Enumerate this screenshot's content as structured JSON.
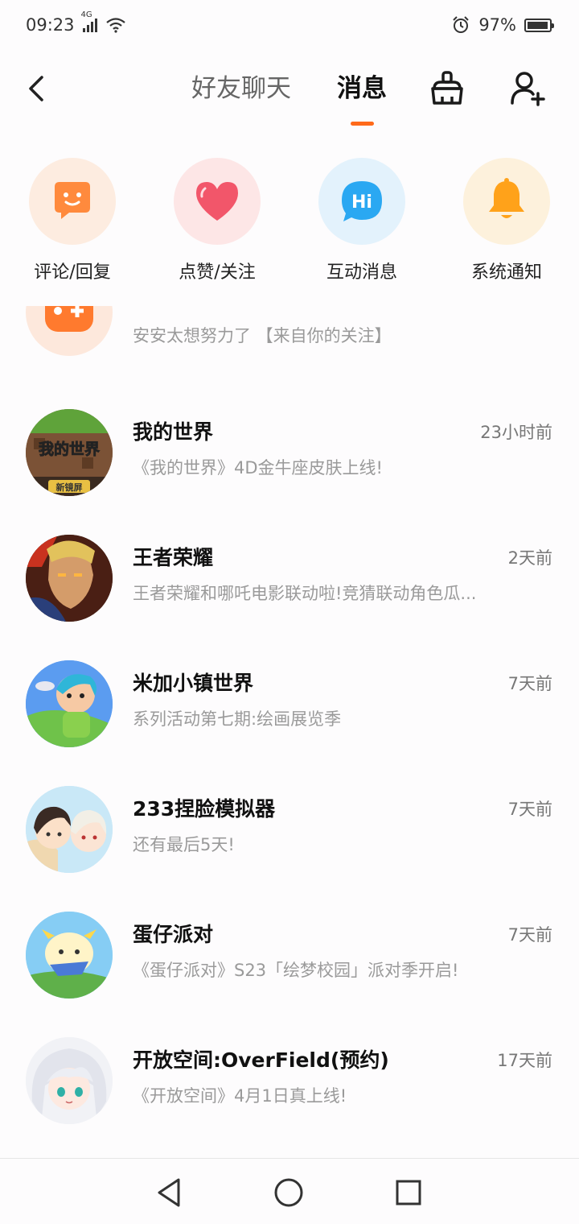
{
  "status_bar": {
    "time": "09:23",
    "network": "4G",
    "battery": "97%"
  },
  "header": {
    "tab_friends": "好友聊天",
    "tab_messages": "消息"
  },
  "categories": [
    {
      "label": "评论/回复",
      "icon": "smile-chat-icon",
      "color": "#ff8a3d",
      "bg": "#fdece0"
    },
    {
      "label": "点赞/关注",
      "icon": "heart-icon",
      "color": "#f2566a",
      "bg": "#fde6e6"
    },
    {
      "label": "互动消息",
      "icon": "hi-bubble-icon",
      "color": "#2aa8f2",
      "bg": "#e3f2fc"
    },
    {
      "label": "系统通知",
      "icon": "bell-icon",
      "color": "#ffa21a",
      "bg": "#fdf1dc"
    }
  ],
  "messages": [
    {
      "title": "",
      "time": "",
      "subtitle": "安安太想努力了 【来自你的关注】"
    },
    {
      "title": "我的世界",
      "time": "23小时前",
      "subtitle": "《我的世界》4D金牛座皮肤上线!",
      "avatar_text": "我的世界",
      "avatar_badge": "新镜屏"
    },
    {
      "title": "王者荣耀",
      "time": "2天前",
      "subtitle": "王者荣耀和哪吒电影联动啦!竞猜联动角色瓜..."
    },
    {
      "title": "米加小镇世界",
      "time": "7天前",
      "subtitle": "系列活动第七期:绘画展览季"
    },
    {
      "title": "233捏脸模拟器",
      "time": "7天前",
      "subtitle": "还有最后5天!"
    },
    {
      "title": "蛋仔派对",
      "time": "7天前",
      "subtitle": "《蛋仔派对》S23「绘梦校园」派对季开启!"
    },
    {
      "title": "开放空间:OverField(预约)",
      "time": "17天前",
      "subtitle": "《开放空间》4月1日真上线!"
    }
  ]
}
